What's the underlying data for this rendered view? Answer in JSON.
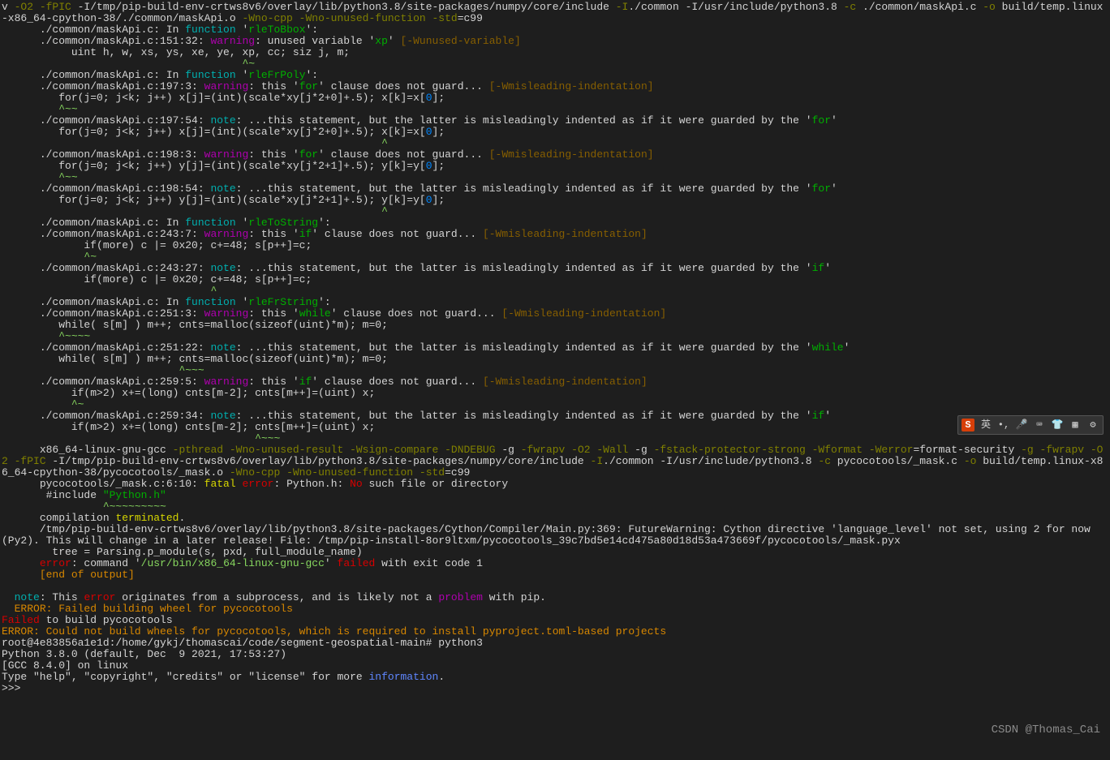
{
  "lines": {
    "l0a": "v ",
    "l0b": "-O2 -fPIC",
    "l0c": " -I/tmp/pip-build-env-crtws8v6/overlay/lib/python3.8/site-packages/numpy/core/include ",
    "l0d": "-I",
    "l0e": "./common -I/usr/include/python3.8 ",
    "l0f": "-c",
    "l0g": " ./common/maskApi.c ",
    "l0h": "-o",
    "l0i": " build/temp.linux-x86_64-cpython-38/./common/maskApi.o ",
    "l0j": "-Wno-cpp -Wno-unused-function -std",
    "l0k": "=c99",
    "l1a": "      ./common/maskApi.c: In ",
    "l1b": "function",
    "l1c": " '",
    "l1d": "rleToBbox",
    "l1e": "':",
    "l2a": "      ./common/maskApi.c:151:32: ",
    "l2b": "warning",
    "l2c": ": unused variable '",
    "l2d": "xp",
    "l2e": "' ",
    "l2f": "[-Wunused-variable]",
    "l3": "           uint h, w, xs, ys, xe, ye, xp, cc; siz j, m;",
    "l4a": "                                      ",
    "l4b": "^~",
    "l5a": "      ./common/maskApi.c: In ",
    "l5b": "function",
    "l5c": " '",
    "l5d": "rleFrPoly",
    "l5e": "':",
    "l6a": "      ./common/maskApi.c:197:3: ",
    "l6b": "warning",
    "l6c": ": this '",
    "l6d": "for",
    "l6e": "' clause does not guard... ",
    "l6f": "[-Wmisleading-indentation]",
    "l7a": "         for(j=0; j<k; j++) x[j]=(int)(scale*xy[j*2+0]+.5); x[k]=x[",
    "l7b": "0",
    "l7c": "];",
    "l8a": "         ",
    "l8b": "^~~",
    "l9a": "      ./common/maskApi.c:197:54: ",
    "l9b": "note",
    "l9c": ": ...this statement, but the latter is misleadingly indented as if it were guarded by the '",
    "l9d": "for",
    "l9e": "'",
    "l10a": "         for(j=0; j<k; j++) x[j]=(int)(scale*xy[j*2+0]+.5); x[k]=x[",
    "l10b": "0",
    "l10c": "];",
    "l11a": "                                                            ",
    "l11b": "^",
    "l12a": "      ./common/maskApi.c:198:3: ",
    "l12b": "warning",
    "l12c": ": this '",
    "l12d": "for",
    "l12e": "' clause does not guard... ",
    "l12f": "[-Wmisleading-indentation]",
    "l13a": "         for(j=0; j<k; j++) y[j]=(int)(scale*xy[j*2+1]+.5); y[k]=y[",
    "l13b": "0",
    "l13c": "];",
    "l14a": "         ",
    "l14b": "^~~",
    "l15a": "      ./common/maskApi.c:198:54: ",
    "l15b": "note",
    "l15c": ": ...this statement, but the latter is misleadingly indented as if it were guarded by the '",
    "l15d": "for",
    "l15e": "'",
    "l16a": "         for(j=0; j<k; j++) y[j]=(int)(scale*xy[j*2+1]+.5); y[k]=y[",
    "l16b": "0",
    "l16c": "];",
    "l17a": "                                                            ",
    "l17b": "^",
    "l18a": "      ./common/maskApi.c: In ",
    "l18b": "function",
    "l18c": " '",
    "l18d": "rleToString",
    "l18e": "':",
    "l19a": "      ./common/maskApi.c:243:7: ",
    "l19b": "warning",
    "l19c": ": this '",
    "l19d": "if",
    "l19e": "' clause does not guard... ",
    "l19f": "[-Wmisleading-indentation]",
    "l20": "             if(more) c |= 0x20; c+=48; s[p++]=c;",
    "l21a": "             ",
    "l21b": "^~",
    "l22a": "      ./common/maskApi.c:243:27: ",
    "l22b": "note",
    "l22c": ": ...this statement, but the latter is misleadingly indented as if it were guarded by the '",
    "l22d": "if",
    "l22e": "'",
    "l23": "             if(more) c |= 0x20; c+=48; s[p++]=c;",
    "l24a": "                                 ",
    "l24b": "^",
    "l25a": "      ./common/maskApi.c: In ",
    "l25b": "function",
    "l25c": " '",
    "l25d": "rleFrString",
    "l25e": "':",
    "l26a": "      ./common/maskApi.c:251:3: ",
    "l26b": "warning",
    "l26c": ": this '",
    "l26d": "while",
    "l26e": "' clause does not guard... ",
    "l26f": "[-Wmisleading-indentation]",
    "l27": "         while( s[m] ) m++; cnts=malloc(sizeof(uint)*m); m=0;",
    "l28a": "         ",
    "l28b": "^~~~~",
    "l29a": "      ./common/maskApi.c:251:22: ",
    "l29b": "note",
    "l29c": ": ...this statement, but the latter is misleadingly indented as if it were guarded by the '",
    "l29d": "while",
    "l29e": "'",
    "l30": "         while( s[m] ) m++; cnts=malloc(sizeof(uint)*m); m=0;",
    "l31a": "                            ",
    "l31b": "^~~~",
    "l32a": "      ./common/maskApi.c:259:5: ",
    "l32b": "warning",
    "l32c": ": this '",
    "l32d": "if",
    "l32e": "' clause does not guard... ",
    "l32f": "[-Wmisleading-indentation]",
    "l33": "           if(m>2) x+=(long) cnts[m-2]; cnts[m++]=(uint) x;",
    "l34a": "           ",
    "l34b": "^~",
    "l35a": "      ./common/maskApi.c:259:34: ",
    "l35b": "note",
    "l35c": ": ...this statement, but the latter is misleadingly indented as if it were guarded by the '",
    "l35d": "if",
    "l35e": "'",
    "l36": "           if(m>2) x+=(long) cnts[m-2]; cnts[m++]=(uint) x;",
    "l37a": "                                        ",
    "l37b": "^~~~",
    "l38a": "      x86_64-linux-gnu-gcc ",
    "l38b": "-pthread -Wno-unused-result -Wsign-compare -DNDEBUG",
    "l38c": " -g ",
    "l38d": "-fwrapv -O2 -Wall",
    "l38e": " -g ",
    "l38f": "-fstack-protector-strong -Wformat -Werror",
    "l38g": "=format-security ",
    "l38h": "-g -fwrapv -O2 -fPIC",
    "l38i": " -I/tmp/pip-build-env-crtws8v6/overlay/lib/python3.8/site-packages/numpy/core/include ",
    "l38j": "-I",
    "l38k": "./common -I/usr/include/python3.8 ",
    "l38l": "-c",
    "l38m": " pycocotools/_mask.c ",
    "l38n": "-o",
    "l38o": " build/temp.linux-x86_64-cpython-38/pycocotools/_mask.o ",
    "l38p": "-Wno-cpp -Wno-unused-function -std",
    "l38q": "=c99",
    "l39a": "      pycocotools/_mask.c:6:10: ",
    "l39b": "fatal ",
    "l39c": "error",
    "l39d": ": Python.h: ",
    "l39e": "No",
    "l39f": " such file or directory",
    "l40a": "       #include ",
    "l40b": "\"Python.h\"",
    "l41a": "                ",
    "l41b": "^~~~~~~~~~",
    "l42a": "      compilation ",
    "l42b": "terminated",
    "l42c": ".",
    "l43": "      /tmp/pip-build-env-crtws8v6/overlay/lib/python3.8/site-packages/Cython/Compiler/Main.py:369: FutureWarning: Cython directive 'language_level' not set, using 2 for now (Py2). This will change in a later release! File: /tmp/pip-install-8or9ltxm/pycocotools_39c7bd5e14cd475a80d18d53a473669f/pycocotools/_mask.pyx",
    "l44": "        tree = Parsing.p_module(s, pxd, full_module_name)",
    "l45a": "      ",
    "l45b": "error",
    "l45c": ": command '",
    "l45d": "/usr/bin/x86_64-linux-gnu-gcc",
    "l45e": "' ",
    "l45f": "failed",
    "l45g": " with exit code 1",
    "l46a": "      ",
    "l46b": "[end of output]",
    "lblank": "  ",
    "l47a": "  ",
    "l47b": "note",
    "l47c": ": This ",
    "l47d": "error",
    "l47e": " originates from a subprocess, and is likely not a ",
    "l47f": "problem",
    "l47g": " with pip.",
    "l48": "  ERROR: Failed building wheel for pycocotools",
    "l49a": "Failed",
    "l49b": " to build pycocotools",
    "l50": "ERROR: Could not build wheels for pycocotools, which is required to install pyproject.toml-based projects",
    "l51": "root@4e83856a1e1d:/home/gykj/thomascai/code/segment-geospatial-main# python3",
    "l52": "Python 3.8.0 (default, Dec  9 2021, 17:53:27) ",
    "l53": "[GCC 8.4.0] on linux",
    "l54a": "Type \"help\", \"copyright\", \"credits\" or \"license\" for more ",
    "l54b": "information",
    "l54c": ".",
    "l55": ">>> "
  },
  "watermark": "CSDN @Thomas_Cai",
  "toolbar": {
    "ime": "S",
    "lang": "英"
  }
}
